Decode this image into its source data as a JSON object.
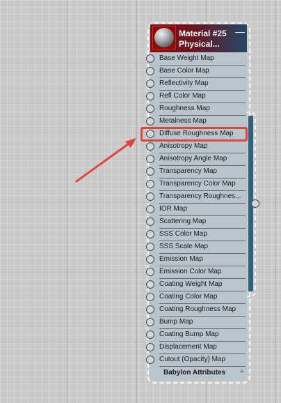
{
  "node": {
    "title_line1": "Material #25",
    "title_line2": "Physical...",
    "collapse_symbol": "—",
    "inputs": [
      {
        "label": "Base Weight Map"
      },
      {
        "label": "Base Color Map"
      },
      {
        "label": "Reflectivity Map"
      },
      {
        "label": "Refl Color Map"
      },
      {
        "label": "Roughness Map"
      },
      {
        "label": "Metalness Map"
      },
      {
        "label": "Diffuse Roughness Map"
      },
      {
        "label": "Anisotropy Map"
      },
      {
        "label": "Anisotropy Angle Map"
      },
      {
        "label": "Transparency Map"
      },
      {
        "label": "Transparency Color Map"
      },
      {
        "label": "Transparency Roughnes..."
      },
      {
        "label": "IOR Map"
      },
      {
        "label": "Scattering Map"
      },
      {
        "label": "SSS Color Map"
      },
      {
        "label": "SSS Scale Map"
      },
      {
        "label": "Emission Map"
      },
      {
        "label": "Emission Color Map"
      },
      {
        "label": "Coating Weight Map"
      },
      {
        "label": "Coating Color Map"
      },
      {
        "label": "Coating Roughness Map"
      },
      {
        "label": "Bump Map"
      },
      {
        "label": "Coating Bump Map"
      },
      {
        "label": "Displacement Map"
      },
      {
        "label": "Cutout (Opacity) Map"
      }
    ],
    "footer_label": "Babylon Attributes",
    "footer_plus": "+"
  },
  "colors": {
    "header_red": "#8c0b0b",
    "header_blue": "#234865",
    "node_body": "#b9c4cc",
    "output_bar": "#30627f",
    "annotation_red": "#e0443e"
  },
  "annotation": {
    "highlighted_input": "Diffuse Roughness Map"
  }
}
